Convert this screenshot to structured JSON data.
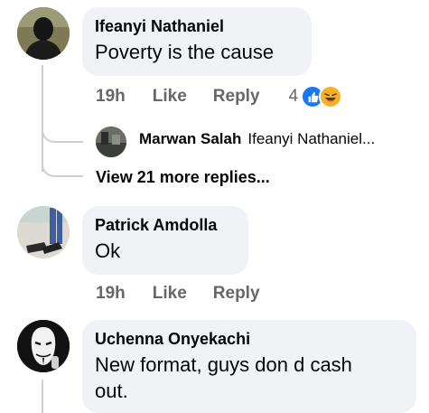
{
  "comments": [
    {
      "author": "Ifeanyi Nathaniel",
      "text": "Poverty is the cause",
      "time": "19h",
      "like": "Like",
      "reply": "Reply",
      "reactions_count": "4"
    },
    {
      "author": "Patrick Amdolla",
      "text": "Ok",
      "time": "19h",
      "like": "Like",
      "reply": "Reply"
    },
    {
      "author": "Uchenna Onyekachi",
      "text": "New format, guys don d cash out."
    }
  ],
  "reply_preview": {
    "author": "Marwan Salah",
    "snippet": "Ifeanyi Nathaniel..."
  },
  "view_more": "View 21 more replies...",
  "colors": {
    "bubble": "#f0f2f5",
    "meta": "#65676b",
    "text": "#050505",
    "like_blue": "#1877f2",
    "haha_yellow": "#f7b125"
  }
}
